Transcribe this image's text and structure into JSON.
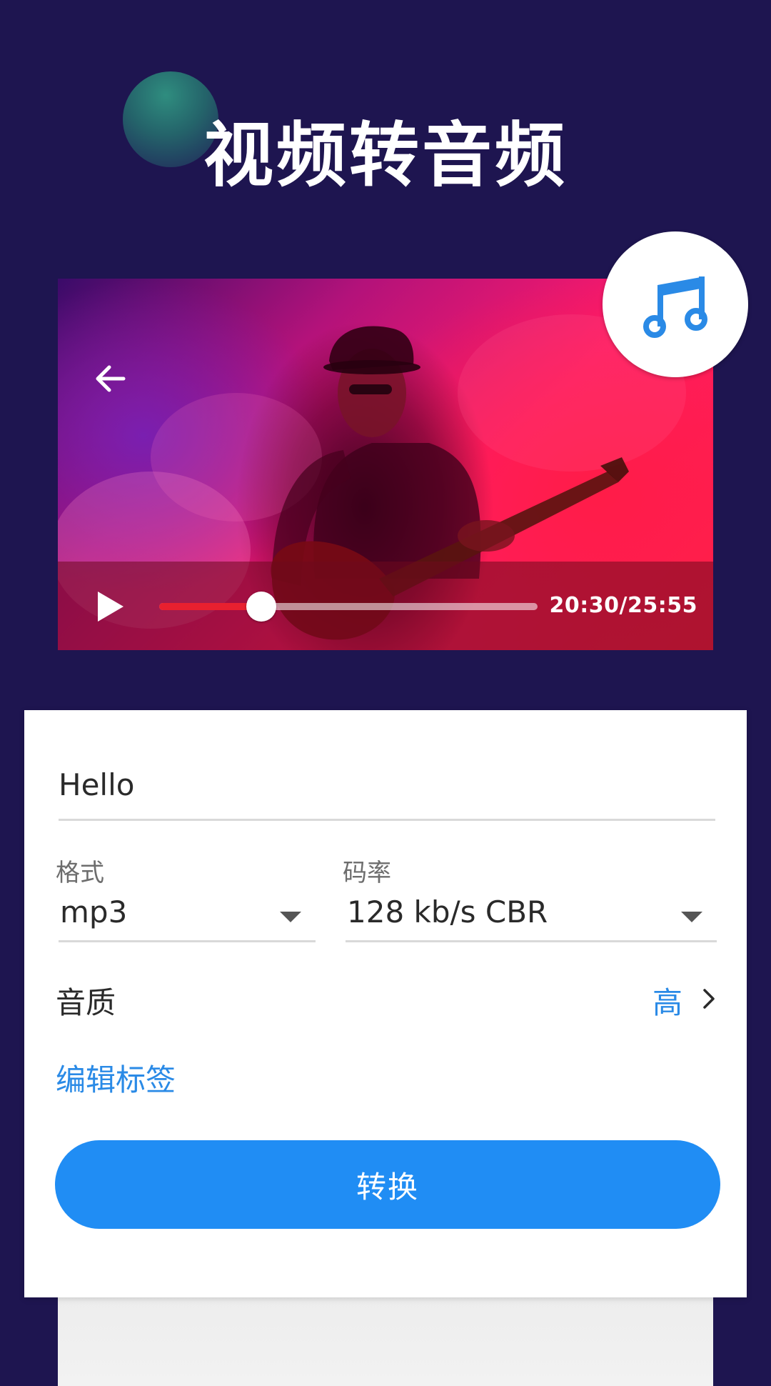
{
  "header": {
    "title": "视频转音频"
  },
  "player": {
    "back_icon": "arrow-left-icon",
    "play_icon": "play-icon",
    "badge_icon": "music-note-icon",
    "progress": 0.27,
    "time": "20:30/25:55",
    "colors": {
      "seek_fill": "#e8202f",
      "seek_track": "#ffffff"
    }
  },
  "form": {
    "file_name": "Hello",
    "format": {
      "label": "格式",
      "value": "mp3"
    },
    "bitrate": {
      "label": "码率",
      "value": "128 kb/s CBR"
    },
    "quality": {
      "label": "音质",
      "value": "高"
    },
    "edit_tags": "编辑标签",
    "convert": "转换"
  },
  "colors": {
    "background": "#1e1550",
    "accent": "#208df4",
    "link": "#2a8ae6"
  }
}
